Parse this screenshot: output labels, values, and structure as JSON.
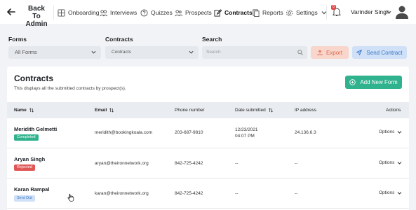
{
  "nav": {
    "back_label": "Back To Admin",
    "items": [
      {
        "label": "Onboarding",
        "icon": "grid-icon"
      },
      {
        "label": "Interviews",
        "icon": "people-icon"
      },
      {
        "label": "Quizzes",
        "icon": "question-icon"
      },
      {
        "label": "Prospects",
        "icon": "prospects-icon"
      },
      {
        "label": "Contracts",
        "icon": "edit-icon",
        "active": true
      },
      {
        "label": "Reports",
        "icon": "document-icon"
      },
      {
        "label": "Settings",
        "icon": "gear-icon"
      }
    ],
    "notification_count": "0",
    "user_name": "Varinder Singh"
  },
  "filters": {
    "forms_label": "Forms",
    "forms_value": "All Forms",
    "contracts_label": "Contracts",
    "contracts_value": "Contracts",
    "search_label": "Search",
    "search_placeholder": "Search",
    "export_label": "Export",
    "send_label": "Send Contract"
  },
  "card": {
    "title": "Contracts",
    "subtitle": "This displays all the submitted contracts by prospect(s).",
    "add_button": "Add New Form"
  },
  "table": {
    "headers": {
      "name": "Name",
      "email": "Email",
      "phone": "Phone number",
      "date": "Date submitted",
      "ip": "IP address",
      "actions": "Actions"
    },
    "rows": [
      {
        "name": "Meridith Gelmetti",
        "status": "Completed",
        "email": "meridith@bookingkoala.com",
        "phone": "203-687-9810",
        "date": "12/23/2021",
        "time": "04:07 PM",
        "ip": "24.136.6.3",
        "options": "Options"
      },
      {
        "name": "Aryan Singh",
        "status": "Rejected",
        "email": "aryan@theironnetwork.org",
        "phone": "842-725-4242",
        "date": "--",
        "time": "",
        "ip": "--",
        "options": "Options"
      },
      {
        "name": "Karan Rampal",
        "status": "Sent Out",
        "email": "karan@theironnetwork.org",
        "phone": "842-725-4242",
        "date": "--",
        "time": "",
        "ip": "--",
        "options": "Options"
      }
    ]
  },
  "colors": {
    "primary_green": "#2fb28d",
    "export_bg": "#f8d6cc",
    "send_bg": "#cfe0f7",
    "rejected_red": "#e05656"
  }
}
